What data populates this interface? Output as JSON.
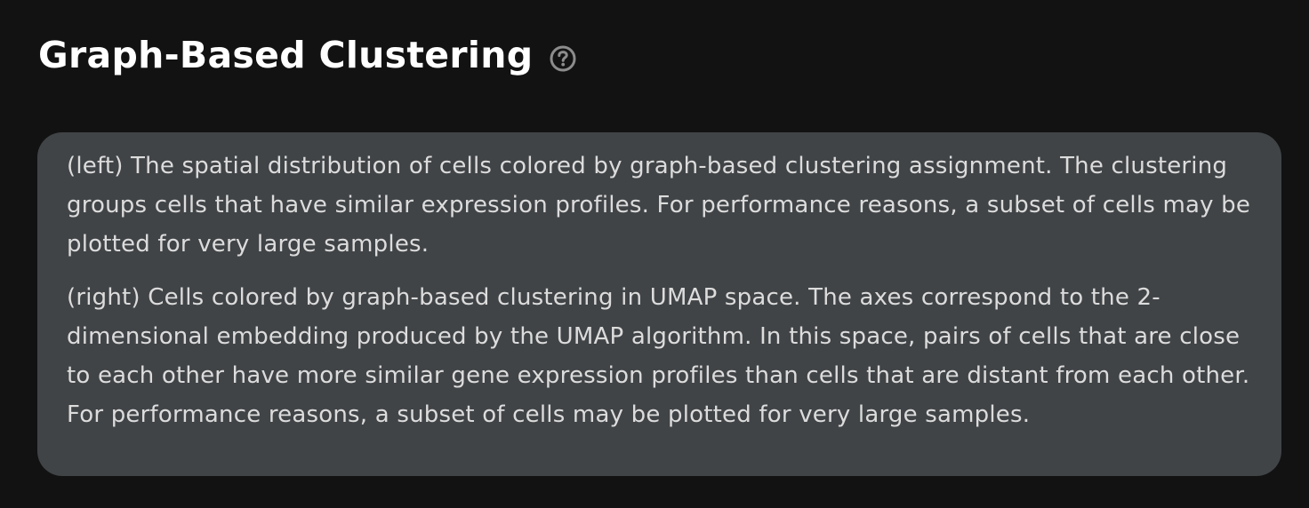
{
  "section": {
    "title": "Graph-Based Clustering",
    "help_icon": "question-circle-icon"
  },
  "description": {
    "paragraphs": [
      "(left) The spatial distribution of cells colored by graph-based clustering assignment. The clustering groups cells that have similar expression profiles. For performance reasons, a subset of cells may be plotted for very large samples.",
      "(right) Cells colored by graph-based clustering in UMAP space. The axes correspond to the 2-dimensional embedding produced by the UMAP algorithm. In this space, pairs of cells that are close to each other have more similar gene expression profiles than cells that are distant from each other. For performance reasons, a subset of cells may be plotted for very large samples."
    ]
  },
  "colors": {
    "background": "#121212",
    "panel": "#414447",
    "title_text": "#ffffff",
    "body_text": "#dcdcdc",
    "icon": "#8c8c8c"
  }
}
